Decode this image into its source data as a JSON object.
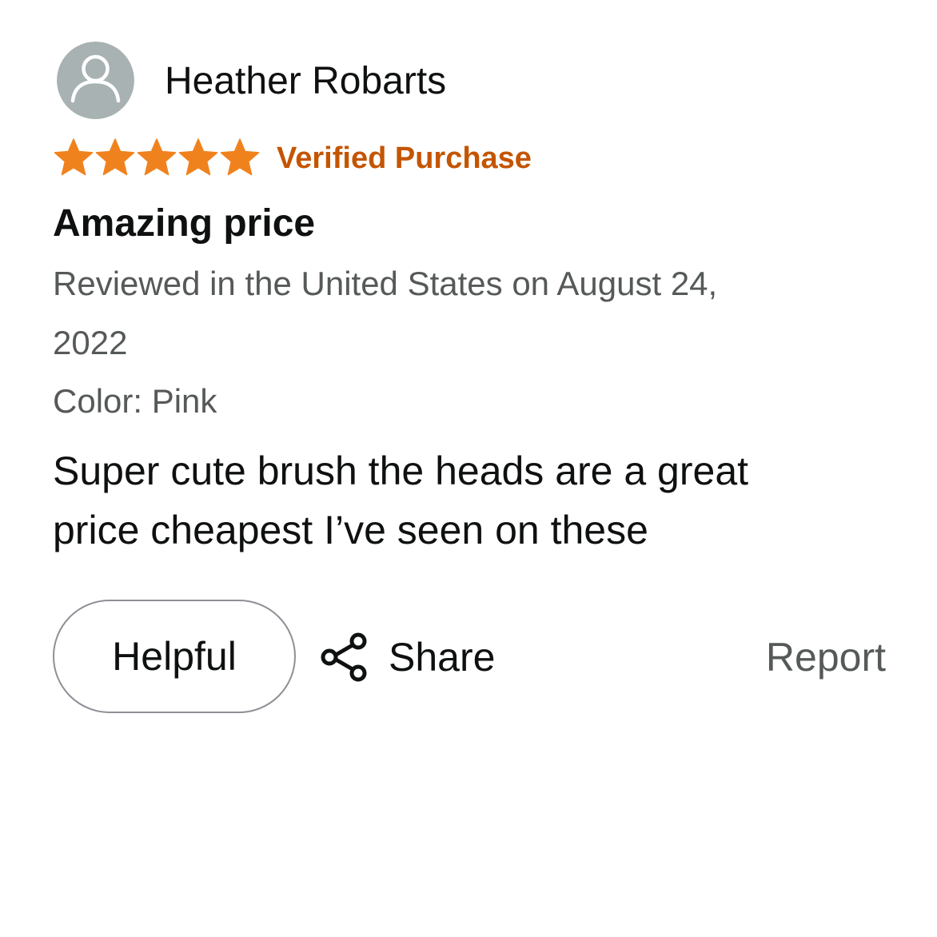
{
  "reviewer": {
    "name": "Heather Robarts",
    "avatar_icon": "user-silhouette-icon"
  },
  "rating": {
    "stars": 5,
    "max": 5,
    "star_color": "#f0821e",
    "verified_label": "Verified Purchase",
    "verified_color": "#c45500"
  },
  "review": {
    "title": "Amazing price",
    "meta_line_1": "Reviewed in the United States on August 24,",
    "meta_line_2": "2022",
    "color_variant": "Color: Pink",
    "body_line_1": "Super cute brush the heads are a great",
    "body_line_2": "price cheapest I’ve seen on these"
  },
  "actions": {
    "helpful_label": "Helpful",
    "share_label": "Share",
    "share_icon": "share-icon",
    "report_label": "Report"
  }
}
